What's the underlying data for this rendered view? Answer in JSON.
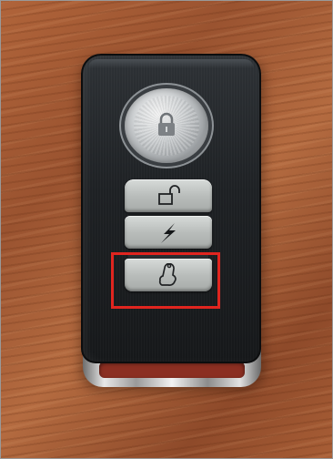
{
  "scene": {
    "subject": "",
    "buttons": [
      {
        "id": "lock",
        "icon": "lock-icon"
      },
      {
        "id": "unlock",
        "icon": "unlock-icon"
      },
      {
        "id": "signal",
        "icon": "lightning-icon"
      },
      {
        "id": "bell",
        "icon": "bell-icon"
      }
    ],
    "highlight": {
      "target": "bell",
      "color": "#e0251f"
    }
  },
  "colors": {
    "fob_body": "#1e2124",
    "button_face": "#b9bdbb",
    "highlight": "#e0251f",
    "surface_wood": "#a85e36"
  }
}
